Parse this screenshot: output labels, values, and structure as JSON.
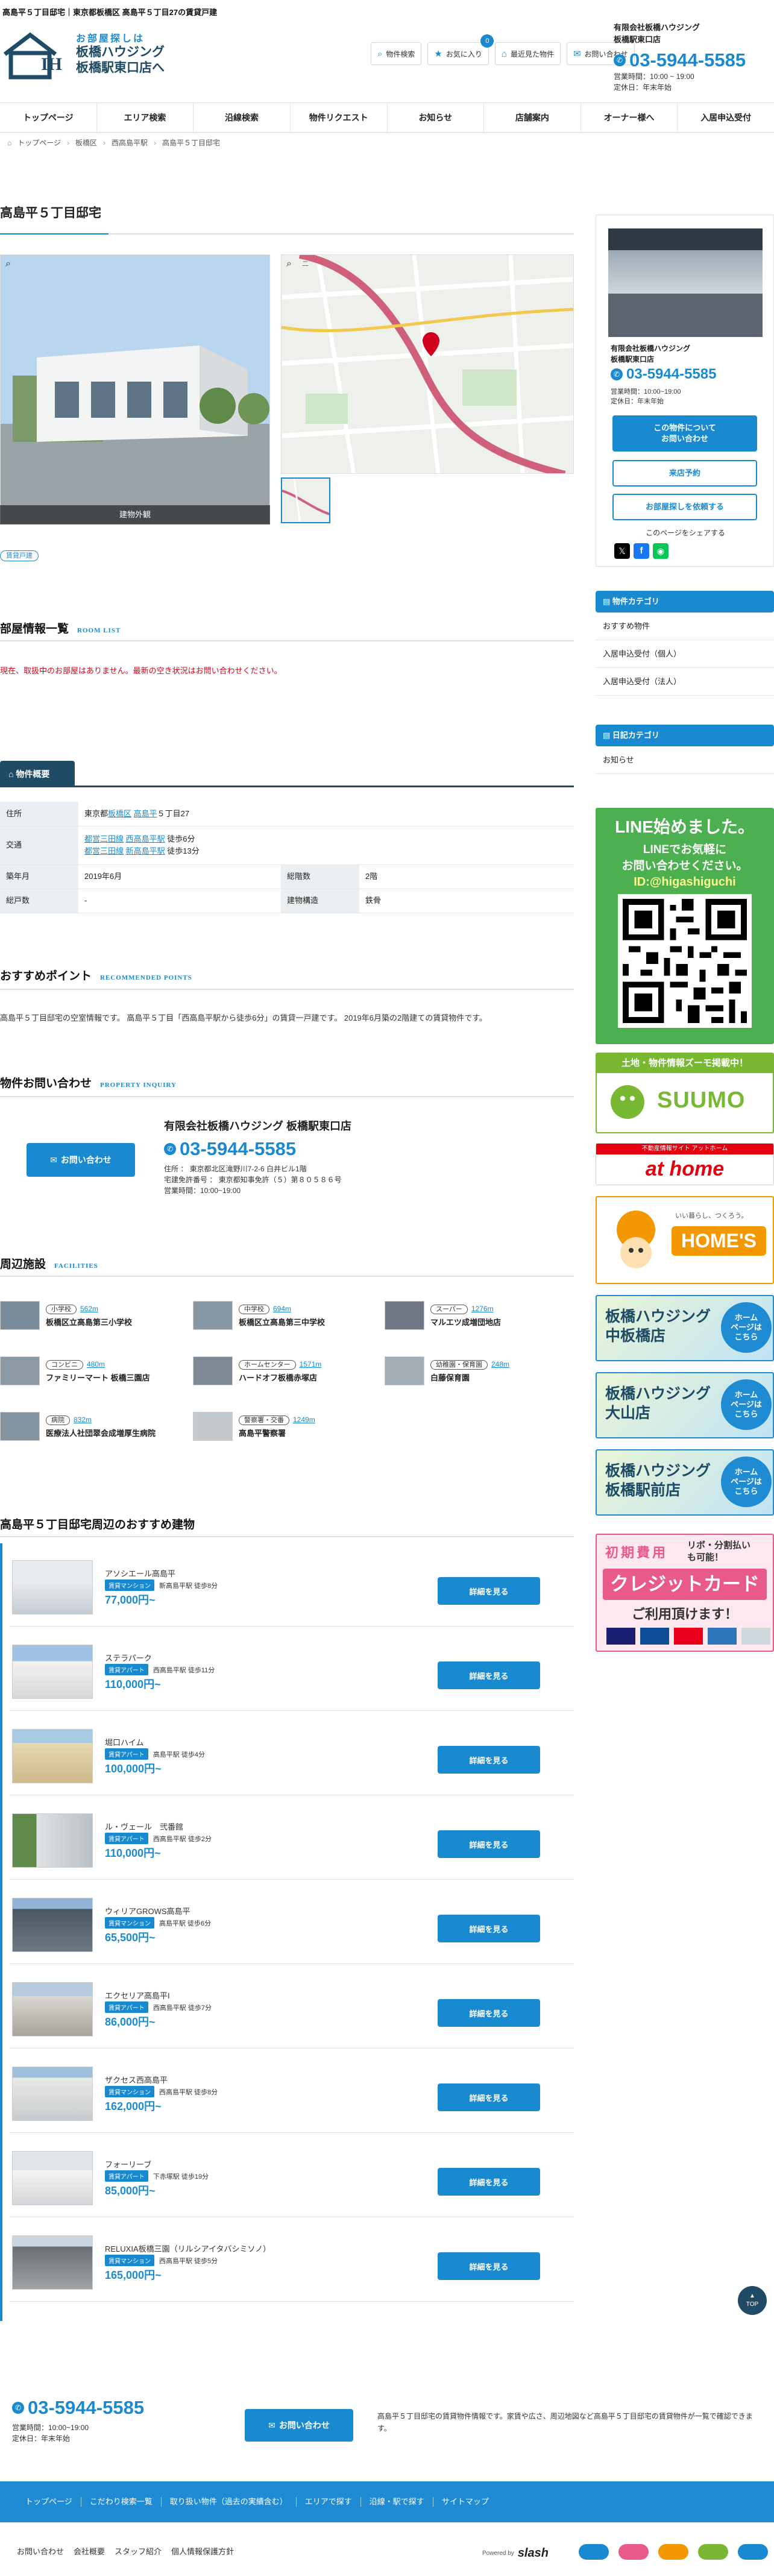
{
  "page_title": "高島平５丁目邸宅｜東京都板橋区 高島平５丁目27の賃貸戸建",
  "header": {
    "logo_mark": "IH",
    "logo_line1": "お部屋探しは",
    "logo_line2": "板橋ハウジング",
    "logo_line3": "板橋駅東口店へ",
    "nav": [
      {
        "label": "物件検索",
        "icon": "search-icon"
      },
      {
        "label": "お気に入り",
        "icon": "star-icon",
        "badge": "0"
      },
      {
        "label": "最近見た物件",
        "icon": "home-icon"
      },
      {
        "label": "お問い合わせ",
        "icon": "mail-icon"
      }
    ],
    "company": "有限会社板橋ハウジング",
    "branch": "板橋駅東口店",
    "tel": "03-5944-5585",
    "hours": "営業時間：10:00 ~ 19:00",
    "holiday": "定休日：年末年始"
  },
  "global_nav": [
    "トップページ",
    "エリア検索",
    "沿線検索",
    "物件リクエスト",
    "お知らせ",
    "店舗案内",
    "オーナー様へ",
    "入居申込受付"
  ],
  "breadcrumb": [
    "トップページ",
    "板橋区",
    "西高島平駅",
    "高島平５丁目邸宅"
  ],
  "property": {
    "title": "高島平５丁目邸宅",
    "photo_caption": "建物外観",
    "tag": "賃貸戸建",
    "map_search": "二"
  },
  "rooms": {
    "title": "部屋情報一覧",
    "title_en": "ROOM LIST",
    "notice": "現在、取扱中のお部屋はありません。最新の空き状況はお問い合わせください。"
  },
  "overview": {
    "tab": "物件概要",
    "address_label": "住所",
    "address_prefix": "東京都",
    "address_link1": "板橋区",
    "address_link2": "高島平",
    "address_suffix": "５丁目27",
    "traffic_label": "交通",
    "traffic": [
      {
        "line": "都営三田線",
        "station": "西高島平駅",
        "walk": "徒歩6分"
      },
      {
        "line": "都営三田線",
        "station": "新高島平駅",
        "walk": "徒歩13分"
      }
    ],
    "built_label": "築年月",
    "built": "2019年6月",
    "floors_label": "総階数",
    "floors": "2階",
    "units_label": "総戸数",
    "units": "-",
    "structure_label": "建物構造",
    "structure": "鉄骨"
  },
  "recommend": {
    "title": "おすすめポイント",
    "title_en": "RECOMMENDED POINTS",
    "text": "高島平５丁目邸宅の空室情報です。 高島平５丁目「西高島平駅から徒歩6分」の賃貸一戸建です。 2019年6月築の2階建ての賃貸物件です。"
  },
  "inquiry": {
    "title": "物件お問い合わせ",
    "title_en": "PROPERTY INQUIRY",
    "button": "お問い合わせ",
    "company": "有限会社板橋ハウジング 板橋駅東口店",
    "tel": "03-5944-5585",
    "address": "住所 ： 東京都北区滝野川7-2-6 白井ビル1階",
    "license": "宅建免許番号 ： 東京都知事免許（５）第８０５８６号",
    "hours": "営業時間：10:00~19:00"
  },
  "facilities": {
    "title": "周辺施設",
    "title_en": "FACILITIES",
    "items": [
      {
        "type": "小学校",
        "dist": "562m",
        "name": "板橋区立高島第三小学校"
      },
      {
        "type": "中学校",
        "dist": "694m",
        "name": "板橋区立高島第三中学校"
      },
      {
        "type": "スーパー",
        "dist": "1276m",
        "name": "マルエツ成増団地店"
      },
      {
        "type": "コンビニ",
        "dist": "480m",
        "name": "ファミリーマート 板橋三園店"
      },
      {
        "type": "ホームセンター",
        "dist": "1571m",
        "name": "ハードオフ板橋赤塚店"
      },
      {
        "type": "幼稚園・保育園",
        "dist": "248m",
        "name": "白藤保育園"
      },
      {
        "type": "病院",
        "dist": "832m",
        "name": "医療法人社団翠会成増厚生病院"
      },
      {
        "type": "警察署・交番",
        "dist": "1249m",
        "name": "高島平警察署"
      }
    ]
  },
  "nearby": {
    "title": "高島平５丁目邸宅周辺のおすすめ建物",
    "button": "詳細を見る",
    "items": [
      {
        "name": "アソシエール高島平",
        "type": "賃貸マンション",
        "access": "新高島平駅 徒歩8分",
        "price": "77,000円~"
      },
      {
        "name": "ステラパーク",
        "type": "賃貸アパート",
        "access": "西高島平駅 徒歩11分",
        "price": "110,000円~"
      },
      {
        "name": "堀口ハイム",
        "type": "賃貸アパート",
        "access": "高島平駅 徒歩4分",
        "price": "100,000円~"
      },
      {
        "name": "ル・ヴェール　弐番館",
        "type": "賃貸アパート",
        "access": "西高島平駅 徒歩2分",
        "price": "110,000円~"
      },
      {
        "name": "ウィリアGROWS高島平",
        "type": "賃貸マンション",
        "access": "高島平駅 徒歩6分",
        "price": "65,500円~"
      },
      {
        "name": "エクセリア高島平I",
        "type": "賃貸アパート",
        "access": "西高島平駅 徒歩7分",
        "price": "86,000円~"
      },
      {
        "name": "ザクセス西高島平",
        "type": "賃貸マンション",
        "access": "西高島平駅 徒歩8分",
        "price": "162,000円~"
      },
      {
        "name": "フォーリーブ",
        "type": "賃貸アパート",
        "access": "下赤塚駅 徒歩19分",
        "price": "85,000円~"
      },
      {
        "name": "RELUXIA板橋三園（リルシアイタバシミソノ）",
        "type": "賃貸マンション",
        "access": "西高島平駅 徒歩5分",
        "price": "165,000円~"
      }
    ]
  },
  "sidebar": {
    "company": "有限会社板橋ハウジング",
    "branch": "板橋駅東口店",
    "tel": "03-5944-5585",
    "hours": "営業時間：10:00~19:00",
    "holiday": "定休日：年末年始",
    "btn_inquiry": "この物件について\nお問い合わせ",
    "btn_visit": "来店予約",
    "btn_request": "お部屋探しを依頼する",
    "share": "このページをシェアする",
    "cat1_title": "物件カテゴリ",
    "cat1_items": [
      "おすすめ物件",
      "入居申込受付（個人）",
      "入居申込受付（法人）"
    ],
    "cat2_title": "日記カテゴリ",
    "cat2_items": [
      "お知らせ"
    ],
    "line_title": "LINE始めました。",
    "line_sub1": "LINEでお気軽に",
    "line_sub2": "お問い合わせください。",
    "line_id": "ID:@higashiguchi",
    "suumo_top": "土地・物件情報ズーモ掲載中！",
    "suumo": "SUUMO",
    "athome_top": "不動産情報サイト アットホーム",
    "athome": "at home",
    "homes": "HOME'S",
    "homes_top": "いい暮らし、つくろう。",
    "store1": "板橋ハウジング\n中板橋店",
    "store2": "板橋ハウジング\n大山店",
    "store3": "板橋ハウジング\n板橋駅前店",
    "store_badge": "ホーム\nページは\nこちら",
    "credit_top": "初期費用",
    "credit_side": "リボ・分割払い\nも可能！",
    "credit_main": "クレジットカード",
    "credit_sub": "ご利用頂けます！"
  },
  "footer": {
    "tel": "03-5944-5585",
    "hours": "営業時間：10:00~19:00",
    "holiday": "定休日：年末年始",
    "button": "お問い合わせ",
    "desc": "高島平５丁目邸宅の賃貸物件情報です。家賃や広さ、周辺地図など高島平５丁目邸宅の賃貸物件が一覧で確認できます。",
    "nav": [
      "トップページ",
      "こだわり検索一覧",
      "取り扱い物件（過去の実績含む）",
      "エリアで探す",
      "沿線・駅で探す",
      "サイトマップ"
    ],
    "bottom": [
      "お問い合わせ",
      "会社概要",
      "スタッフ紹介",
      "個人情報保護方針"
    ],
    "powered": "Powered by",
    "brand": "slash",
    "top": "TOP"
  },
  "colors": {
    "accent": "#1a8ad0",
    "dark": "#1f4b66",
    "red": "#d0021b",
    "line": "#06c755"
  }
}
